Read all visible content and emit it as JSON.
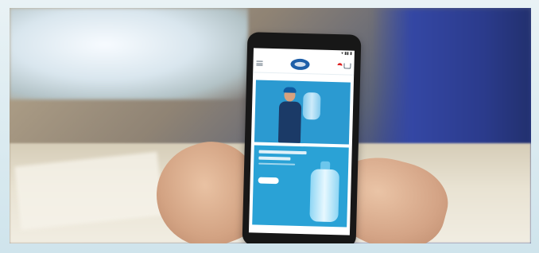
{
  "scene": {
    "subject": "hands-holding-smartphone",
    "background": "train-interior-blurred"
  },
  "phone_app": {
    "top_icons": [
      "menu-icon",
      "brand-logo",
      "flag-icon",
      "cart-icon"
    ],
    "cards": [
      {
        "kind": "hero-banner",
        "image": "delivery-man-with-water-bottle"
      },
      {
        "kind": "promo-card",
        "image": "water-cooler-bottle",
        "has_button": true
      }
    ],
    "colors": {
      "primary_blue": "#2b9ad1",
      "promo_blue": "#2aa2d6",
      "seat_blue": "#2b3b8c"
    }
  }
}
